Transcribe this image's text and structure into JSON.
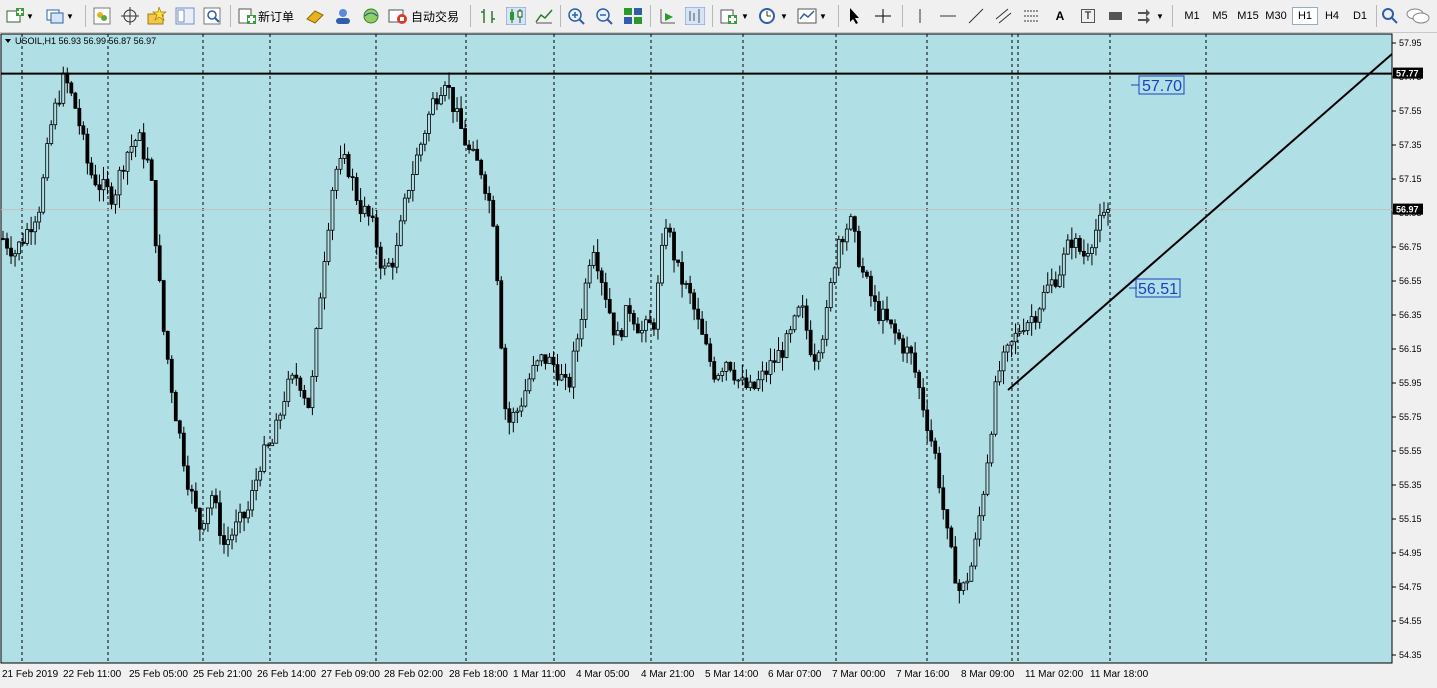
{
  "toolbar": {
    "new_order_label": "新订单",
    "auto_trading_label": "自动交易",
    "timeframes": [
      "M1",
      "M5",
      "M15",
      "M30",
      "H1",
      "H4",
      "D1"
    ],
    "active_timeframe": "H1",
    "line_tools": {
      "text_tool_label": "A",
      "text_label_tool_label": "T"
    }
  },
  "chart": {
    "symbol_info": "USOIL,H1  56.93 56.99 56.87 56.97",
    "background_color": "#b0e0e6",
    "line_color": "#000000",
    "price_axis_labels": [
      "57.95",
      "57.75",
      "57.55",
      "57.35",
      "57.15",
      "56.95",
      "56.75",
      "56.55",
      "56.35",
      "56.15",
      "55.95",
      "55.75",
      "55.55",
      "55.35",
      "55.15",
      "54.95",
      "54.75",
      "54.55",
      "54.35"
    ],
    "time_axis_labels": [
      "21 Feb 2019",
      "22 Feb 11:00",
      "25 Feb 05:00",
      "25 Feb 21:00",
      "26 Feb 14:00",
      "27 Feb 09:00",
      "28 Feb 02:00",
      "28 Feb 18:00",
      "1 Mar 11:00",
      "4 Mar 05:00",
      "4 Mar 21:00",
      "5 Mar 14:00",
      "6 Mar 07:00",
      "7 Mar 00:00",
      "7 Mar 16:00",
      "8 Mar 09:00",
      "11 Mar 02:00",
      "11 Mar 18:00"
    ],
    "horizontal_line": {
      "price": 57.77,
      "label": "57.77"
    },
    "current_price": {
      "price": 56.97,
      "label": "56.97"
    },
    "trendline_labels": [
      {
        "text": "57.70",
        "price": 57.7
      },
      {
        "text": "56.51",
        "price": 56.51
      }
    ]
  },
  "chart_data": {
    "type": "candlestick",
    "symbol": "USOIL",
    "timeframe": "H1",
    "ylim": [
      54.3,
      58.0
    ],
    "series": [
      {
        "segment": "21 Feb - 22 Feb",
        "close_path": [
          56.8,
          56.72,
          56.85,
          57.0,
          57.5,
          57.75,
          57.55,
          57.2,
          57.1,
          57.05,
          57.3,
          57.4
        ]
      },
      {
        "segment": "25 Feb",
        "close_path": [
          57.2,
          56.3,
          55.8,
          55.4,
          55.1,
          55.3,
          55.0,
          55.1
        ]
      },
      {
        "segment": "25 Feb - 27 Feb",
        "close_path": [
          55.2,
          55.5,
          55.6,
          55.9,
          56.0,
          55.8,
          56.6,
          57.2,
          57.25,
          57.0,
          56.9,
          56.6,
          56.7,
          57.1,
          57.35,
          57.6,
          57.75,
          57.5,
          57.3
        ]
      },
      {
        "segment": "28 Feb - 1 Mar",
        "close_path": [
          57.2,
          56.9,
          55.7,
          55.8,
          56.0,
          56.1,
          56.05,
          55.9,
          56.3,
          56.8,
          56.5,
          56.2,
          56.4,
          56.25,
          56.3,
          56.9,
          56.6,
          56.45,
          56.2,
          56.0,
          56.1,
          55.95,
          55.9,
          56.0,
          56.1,
          56.2,
          56.4,
          56.1
        ]
      },
      {
        "segment": "7 Mar - 11 Mar",
        "close_path": [
          56.3,
          56.8,
          56.9,
          56.6,
          56.4,
          56.3,
          56.2,
          56.1,
          55.8,
          55.5,
          55.0,
          54.7,
          54.9,
          55.4,
          56.0,
          56.15,
          56.3,
          56.35,
          56.5,
          56.6,
          56.8,
          56.7,
          56.85,
          56.95
        ]
      }
    ],
    "horizontal_line": 57.77,
    "trendline": {
      "from": {
        "time": "8 Mar 09:00",
        "price": 55.9
      },
      "through": {
        "time": "11 Mar 18:00",
        "price": 56.51
      }
    },
    "last_price": 56.97
  }
}
